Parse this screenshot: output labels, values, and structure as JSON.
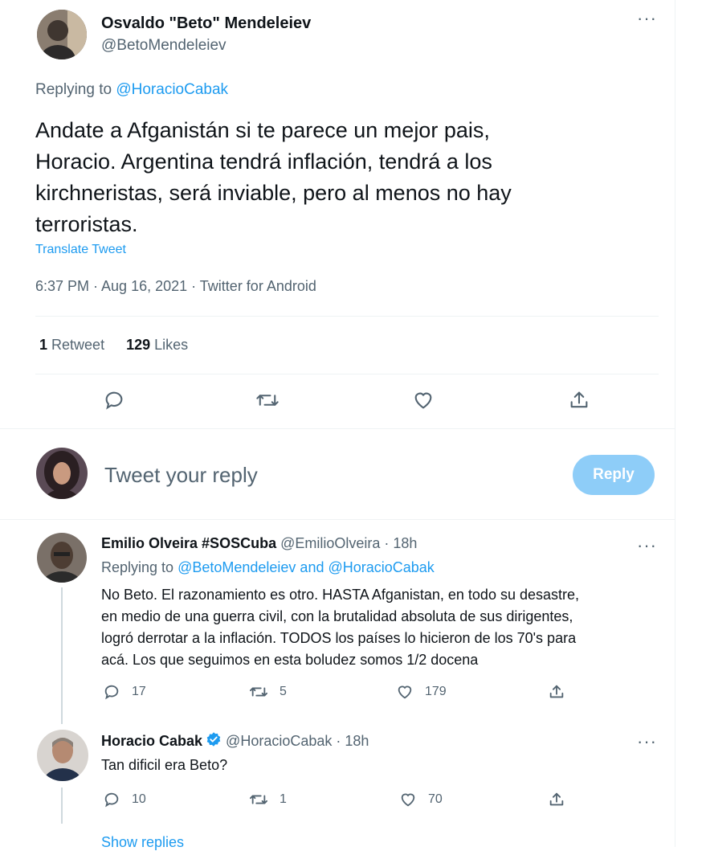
{
  "main_tweet": {
    "author_name": "Osvaldo \"Beto\" Mendeleiev",
    "author_handle": "@BetoMendeleiev",
    "replying_prefix": "Replying to",
    "replying_to": "@HoracioCabak",
    "text_lines": [
      "Andate a Afganistán si te parece un mejor pais,",
      "Horacio. Argentina tendrá inflación, tendrá a los",
      "kirchneristas, será inviable, pero al menos no hay",
      "terroristas."
    ],
    "translate_label": "Translate Tweet",
    "timestamp": "6:37 PM · Aug 16, 2021 · Twitter for Android",
    "retweets_count": "1",
    "retweets_label": "Retweet",
    "likes_count": "129",
    "likes_label": "Likes"
  },
  "composer": {
    "placeholder": "Tweet your reply",
    "reply_button": "Reply"
  },
  "replies": [
    {
      "author_name": "Emilio Olveira #SOSCuba",
      "author_handle": "@EmilioOlveira",
      "time": "· 18h",
      "replying_prefix": "Replying to",
      "replying_to": "@BetoMendeleiev and @HoracioCabak",
      "text_lines": [
        "No Beto. El razonamiento es otro. HASTA Afganistan, en todo su desastre,",
        "en medio de una guerra civil, con la brutalidad absoluta de sus dirigentes,",
        "logró derrotar a la inflación. TODOS los países lo hicieron de los 70's para",
        "acá. Los que seguimos en esta boludez somos 1/2 docena"
      ],
      "reply_count": "17",
      "retweet_count": "5",
      "like_count": "179"
    },
    {
      "author_name": "Horacio Cabak",
      "author_handle": "@HoracioCabak",
      "time": "· 18h",
      "verified": true,
      "text": "Tan dificil era Beto?",
      "reply_count": "10",
      "retweet_count": "1",
      "like_count": "70",
      "show_replies": "Show replies"
    }
  ],
  "colors": {
    "accent": "#1d9bf0",
    "reply_button_disabled": "#8ecdf8",
    "muted_text": "#536471",
    "divider": "#eff3f4"
  }
}
